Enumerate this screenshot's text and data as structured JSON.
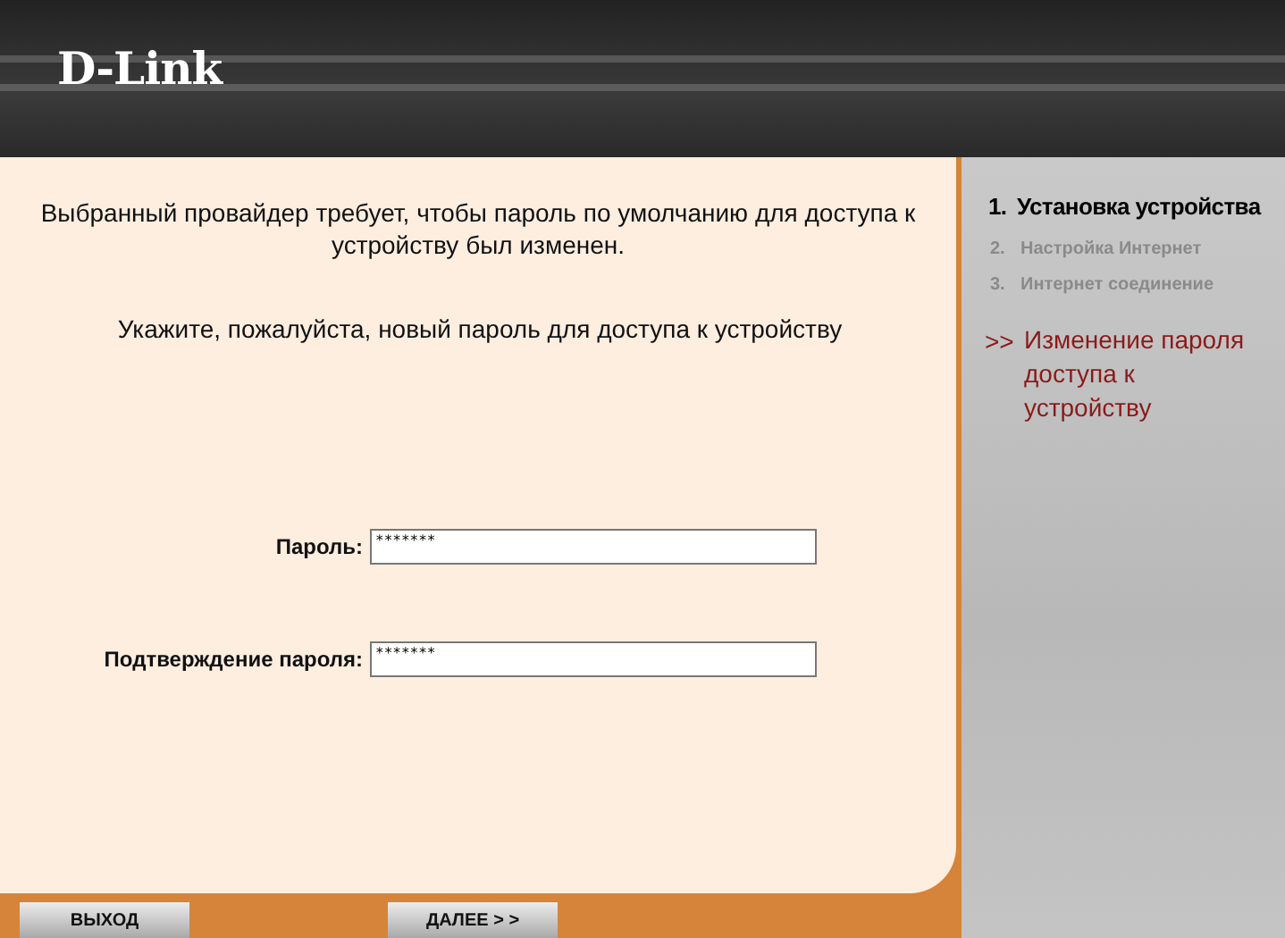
{
  "header": {
    "logo": "D-Link"
  },
  "main": {
    "message": "Выбранный провайдер требует, чтобы пароль по умолчанию для доступа к устройству был изменен.",
    "prompt": "Укажите, пожалуйста, новый пароль для доступа к устройству",
    "fields": [
      {
        "label": "Пароль:",
        "value": "*******"
      },
      {
        "label": "Подтверждение пароля:",
        "value": "*******"
      }
    ]
  },
  "buttons": [
    {
      "label": "ВЫХОД"
    },
    {
      "label": "ДАЛЕЕ > >"
    }
  ],
  "sidebar": {
    "steps": [
      {
        "number": "1.",
        "label": "Установка устройства",
        "selected": true
      },
      {
        "number": "2.",
        "label": "Настройка Интернет",
        "selected": false
      },
      {
        "number": "3.",
        "label": "Интернет соединение",
        "selected": false
      }
    ],
    "substep": {
      "marker": ">>",
      "label": "Изменение пароля доступа к устройству"
    }
  }
}
